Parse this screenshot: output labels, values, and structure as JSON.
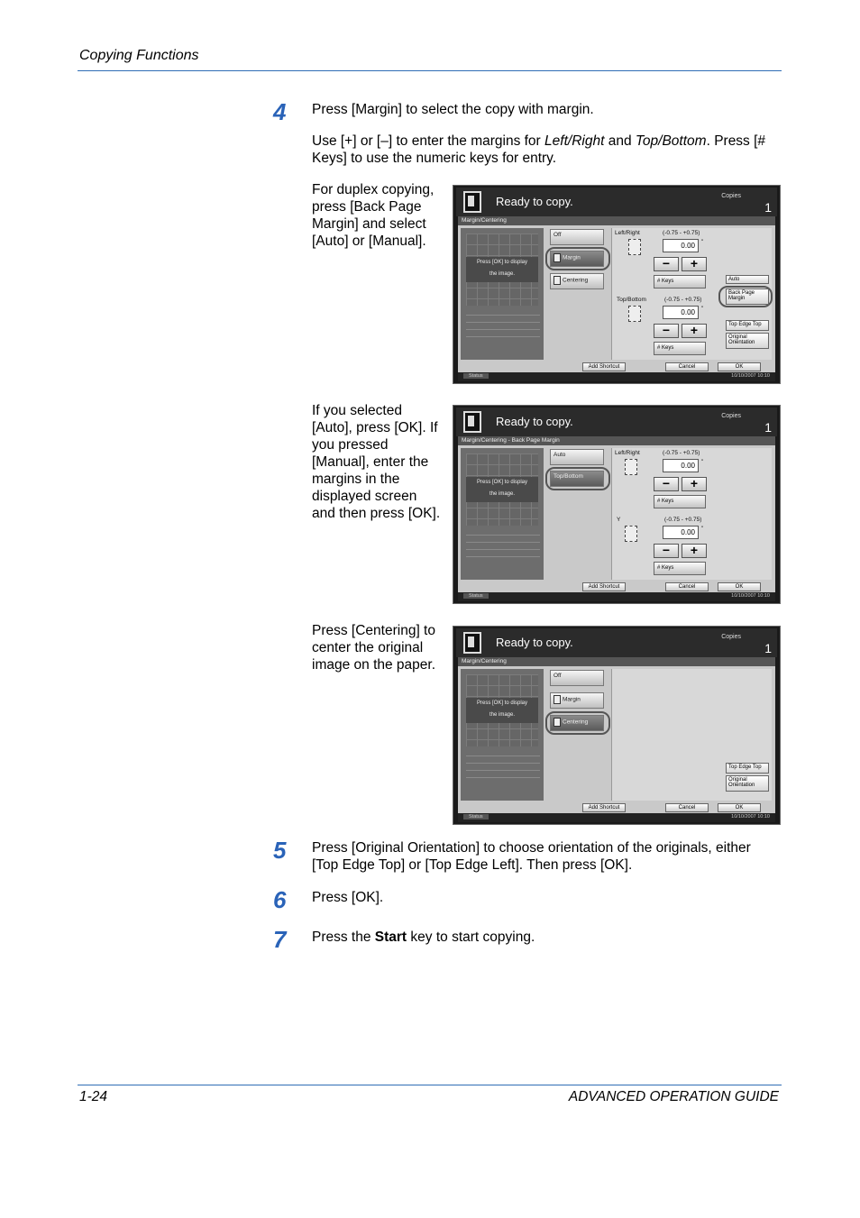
{
  "header": {
    "section": "Copying Functions"
  },
  "steps": {
    "s4": {
      "num": "4",
      "line1": "Press [Margin] to select the copy with margin.",
      "line2a": "Use [+] or [–] to enter the margins for ",
      "line2b": "Left/Right",
      "line2c": " and ",
      "line2d": "Top/Bottom",
      "line2e": ". Press [#",
      "line2f": "Keys] to use the numeric keys for entry."
    },
    "s5": {
      "num": "5",
      "line1": "Press [Original Orientation] to choose orientation of the originals, either",
      "line2": "[Top Edge Top] or [Top Edge Left]. Then press [OK]."
    },
    "s6": {
      "num": "6",
      "text": "Press [OK]."
    },
    "s7": {
      "num": "7",
      "pre": "Press the ",
      "bold": "Start",
      "post": " key to start copying."
    }
  },
  "notes": {
    "n1": [
      "For duplex copying,",
      "press [Back Page",
      "Margin] and select",
      "[Auto] or [Manual]."
    ],
    "n2": [
      "If you selected",
      "[Auto], press [OK]. If",
      "you pressed",
      "[Manual], enter the",
      "margins in the",
      "displayed screen",
      "and then press [OK]."
    ],
    "n3": [
      "Press [Centering] to",
      "center the original",
      "image on the paper."
    ]
  },
  "screens": {
    "common": {
      "ready": "Ready to copy.",
      "copies_label": "Copies",
      "copies_value": "1",
      "preview_msg1": "Press [OK] to display",
      "preview_msg2": "the image.",
      "add_shortcut": "Add Shortcut",
      "cancel": "Cancel",
      "ok": "OK",
      "status": "Status",
      "datetime": "10/10/2007   10:10",
      "range": "(-0.75 - +0.75)",
      "value": "0.00",
      "keys": "# Keys",
      "unit": "\""
    },
    "s1": {
      "breadcrumb": "Margin/Centering",
      "opt_off": "Off",
      "opt_margin": "Margin",
      "opt_centering": "Centering",
      "lr_label": "Left/Right",
      "tb_label": "Top/Bottom",
      "side_auto": "Auto",
      "side_back1": "Back Page",
      "side_back2": "Margin",
      "side_tet": "Top Edge Top",
      "side_orig1": "Original",
      "side_orig2": "Orientation"
    },
    "s2": {
      "breadcrumb": "Margin/Centering - Back Page Margin",
      "opt_auto": "Auto",
      "opt_tb": "Top/Bottom",
      "lr_label": "Left/Right",
      "y_label": "Y"
    },
    "s3": {
      "breadcrumb": "Margin/Centering",
      "opt_off": "Off",
      "opt_margin": "Margin",
      "opt_centering": "Centering",
      "side_tet": "Top Edge Top",
      "side_orig1": "Original",
      "side_orig2": "Orientation"
    }
  },
  "footer": {
    "page": "1-24",
    "guide": "ADVANCED OPERATION GUIDE"
  },
  "colors": {
    "rule": "#2f6db5",
    "step_number": "#2a63b8"
  }
}
